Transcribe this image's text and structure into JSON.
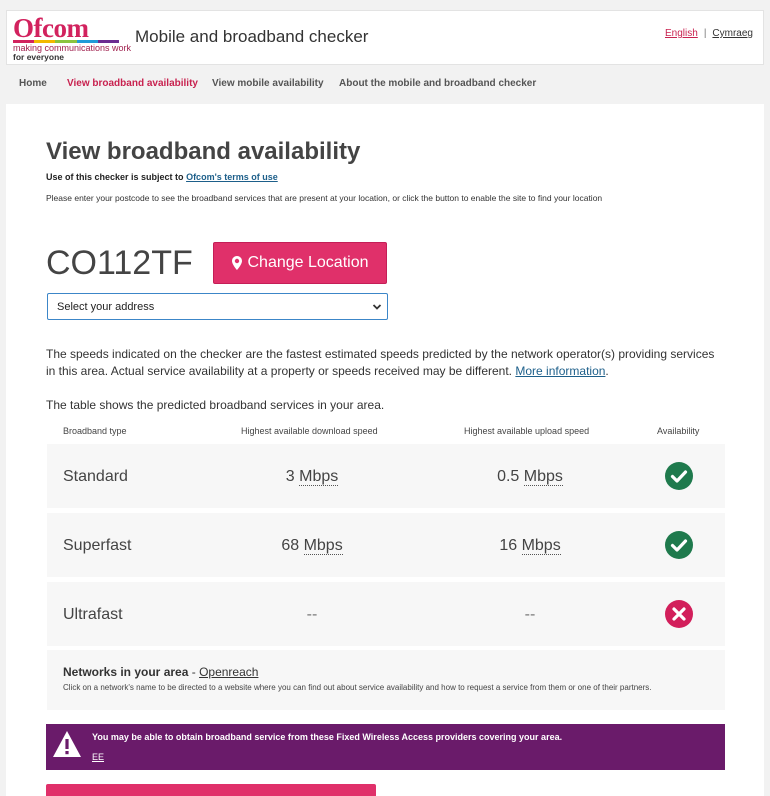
{
  "header": {
    "logo": {
      "wordmark": "Ofcom",
      "tagline": "making communications work",
      "tagline2": "for everyone",
      "bar_colors": [
        "#d2225e",
        "#f2b900",
        "#8ac43f",
        "#1e9bd7",
        "#6b2c91"
      ]
    },
    "app_title": "Mobile and broadband checker",
    "languages": {
      "english": "English",
      "separator": "|",
      "welsh": "Cymraeg"
    }
  },
  "nav": {
    "items": [
      {
        "label": "Home",
        "active": false
      },
      {
        "label": "View broadband availability",
        "active": true
      },
      {
        "label": "View mobile availability",
        "active": false
      },
      {
        "label": "About the mobile and broadband checker",
        "active": false
      }
    ]
  },
  "main": {
    "title": "View broadband availability",
    "terms_prefix": "Use of this checker is subject to",
    "terms_link": "Ofcom's terms of use",
    "instructions": "Please enter your postcode to see the broadband services that are present at your location, or click the button to enable the site to find your location",
    "postcode": "CO112TF",
    "change_location_label": "Change Location",
    "address_select": {
      "selected": "Select your address"
    },
    "speeds_note": "The speeds indicated on the checker are the fastest estimated speeds predicted by the network operator(s) providing services in this area. Actual service availability at a property or speeds received may be different.",
    "more_info_link": "More information",
    "table_note": "The table shows the predicted broadband services in your area."
  },
  "table": {
    "headers": [
      "Broadband type",
      "Highest available download speed",
      "Highest available upload speed",
      "Availability"
    ],
    "rows": [
      {
        "type": "Standard",
        "download_value": "3",
        "download_unit": "Mbps",
        "upload_value": "0.5",
        "upload_unit": "Mbps",
        "available": true
      },
      {
        "type": "Superfast",
        "download_value": "68",
        "download_unit": "Mbps",
        "upload_value": "16",
        "upload_unit": "Mbps",
        "available": true
      },
      {
        "type": "Ultrafast",
        "download_value": "--",
        "download_unit": "",
        "upload_value": "--",
        "upload_unit": "",
        "available": false
      }
    ]
  },
  "networks": {
    "label": "Networks in your area",
    "dash": " - ",
    "operator": "Openreach",
    "help": "Click on a network's name to be directed to a website where you can find out about service availability and how to request a service from them or one of their partners."
  },
  "fwa": {
    "message": "You may be able to obtain broadband service from these Fixed Wireless Access providers covering your area.",
    "provider": "EE"
  },
  "colors": {
    "accent": "#e0306a",
    "available": "#1f7a4d",
    "unavailable": "#d21f5b",
    "fwa_background": "#6a1b6a",
    "link": "#1d5f8a"
  },
  "icons": {
    "change_location": "map-pin-icon",
    "select": "chevron-down-icon",
    "available": "check-circle-icon",
    "unavailable": "cross-circle-icon",
    "warning": "warning-triangle-icon"
  }
}
